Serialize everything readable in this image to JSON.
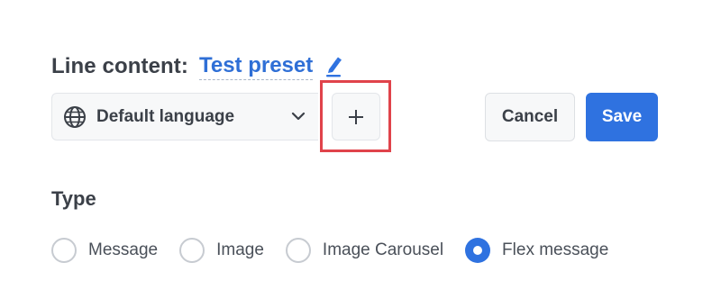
{
  "header": {
    "label": "Line content:",
    "preset_name": "Test preset",
    "edit_icon": "pencil-icon"
  },
  "language_select": {
    "icon": "globe-icon",
    "selected": "Default language",
    "chevron": "chevron-down-icon"
  },
  "add_button": {
    "icon": "plus-icon"
  },
  "actions": {
    "cancel_label": "Cancel",
    "save_label": "Save"
  },
  "type_section": {
    "heading": "Type",
    "options": [
      {
        "label": "Message",
        "checked": false
      },
      {
        "label": "Image",
        "checked": false
      },
      {
        "label": "Image Carousel",
        "checked": false
      },
      {
        "label": "Flex message",
        "checked": true
      }
    ]
  },
  "colors": {
    "accent": "#2f72e0",
    "highlight": "#e0434b"
  }
}
